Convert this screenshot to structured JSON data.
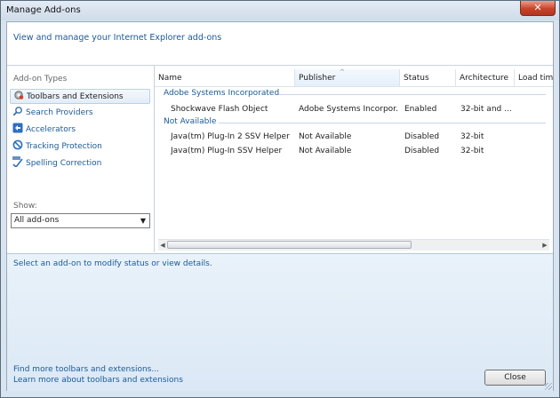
{
  "window": {
    "title": "Manage Add-ons",
    "close_glyph": "✕"
  },
  "header": {
    "text": "View and manage your Internet Explorer add-ons"
  },
  "sidebar": {
    "heading": "Add-on Types",
    "items": [
      {
        "label": "Toolbars and Extensions",
        "icon": "gear-icon",
        "selected": true
      },
      {
        "label": "Search Providers",
        "icon": "magnifier-icon",
        "selected": false
      },
      {
        "label": "Accelerators",
        "icon": "accelerator-icon",
        "selected": false
      },
      {
        "label": "Tracking Protection",
        "icon": "block-icon",
        "selected": false
      },
      {
        "label": "Spelling Correction",
        "icon": "abc-check-icon",
        "selected": false
      }
    ],
    "show_label": "Show:",
    "show_value": "All add-ons"
  },
  "list": {
    "columns": [
      "Name",
      "Publisher",
      "Status",
      "Architecture",
      "Load time"
    ],
    "sorted_column": "Publisher",
    "groups": [
      {
        "label": "Adobe Systems Incorporated",
        "rows": [
          [
            "Shockwave Flash Object",
            "Adobe Systems Incorpor...",
            "Enabled",
            "32-bit and ...",
            ""
          ]
        ]
      },
      {
        "label": "Not Available",
        "rows": [
          [
            "Java(tm) Plug-In 2 SSV Helper",
            "Not Available",
            "Disabled",
            "32-bit",
            ""
          ],
          [
            "Java(tm) Plug-In SSV Helper",
            "Not Available",
            "Disabled",
            "32-bit",
            ""
          ]
        ]
      }
    ]
  },
  "details": {
    "text": "Select an add-on to modify status or view details."
  },
  "footer": {
    "link1": "Find more toolbars and extensions...",
    "link2": "Learn more about toolbars and extensions",
    "close_label": "Close"
  }
}
